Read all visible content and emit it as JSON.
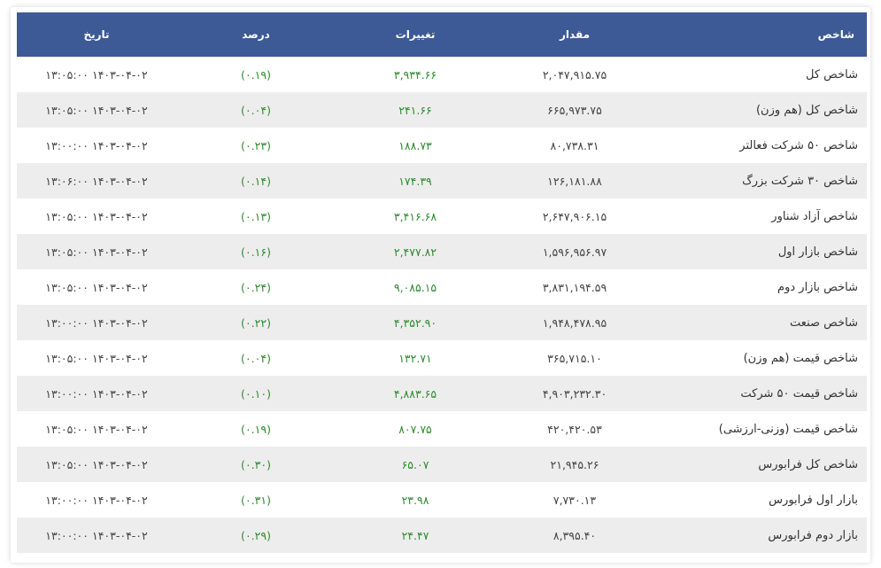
{
  "table": {
    "headers": {
      "name": "شاخص",
      "value": "مقدار",
      "change": "تغییرات",
      "percent": "درصد",
      "date": "تاریخ"
    },
    "rows": [
      {
        "name": "شاخص کل",
        "value": "۲,۰۴۷,۹۱۵.۷۵",
        "change": "۳,۹۳۴.۶۶",
        "percent": "(۰.۱۹)",
        "date": "۱۴۰۳-۰۴-۰۲ ۱۳:۰۵:۰۰"
      },
      {
        "name": "شاخص کل (هم وزن)",
        "value": "۶۶۵,۹۷۳.۷۵",
        "change": "۲۴۱.۶۶",
        "percent": "(۰.۰۴)",
        "date": "۱۴۰۳-۰۴-۰۲ ۱۳:۰۵:۰۰"
      },
      {
        "name": "شاخص ۵۰ شرکت فعالتر",
        "value": "۸۰,۷۳۸.۳۱",
        "change": "۱۸۸.۷۳",
        "percent": "(۰.۲۳)",
        "date": "۱۴۰۳-۰۴-۰۲ ۱۳:۰۰:۰۰"
      },
      {
        "name": "شاخص ۳۰ شرکت بزرگ",
        "value": "۱۲۶,۱۸۱.۸۸",
        "change": "۱۷۴.۳۹",
        "percent": "(۰.۱۴)",
        "date": "۱۴۰۳-۰۴-۰۲ ۱۳:۰۶:۰۰"
      },
      {
        "name": "شاخص آزاد شناور",
        "value": "۲,۶۴۷,۹۰۶.۱۵",
        "change": "۳,۴۱۶.۶۸",
        "percent": "(۰.۱۳)",
        "date": "۱۴۰۳-۰۴-۰۲ ۱۳:۰۵:۰۰"
      },
      {
        "name": "شاخص بازار اول",
        "value": "۱,۵۹۶,۹۵۶.۹۷",
        "change": "۲,۴۷۷.۸۲",
        "percent": "(۰.۱۶)",
        "date": "۱۴۰۳-۰۴-۰۲ ۱۳:۰۵:۰۰"
      },
      {
        "name": "شاخص بازار دوم",
        "value": "۳,۸۳۱,۱۹۴.۵۹",
        "change": "۹,۰۸۵.۱۵",
        "percent": "(۰.۲۴)",
        "date": "۱۴۰۳-۰۴-۰۲ ۱۳:۰۵:۰۰"
      },
      {
        "name": "شاخص صنعت",
        "value": "۱,۹۴۸,۴۷۸.۹۵",
        "change": "۴,۳۵۲.۹۰",
        "percent": "(۰.۲۲)",
        "date": "۱۴۰۳-۰۴-۰۲ ۱۳:۰۰:۰۰"
      },
      {
        "name": "شاخص قیمت (هم وزن)",
        "value": "۳۶۵,۷۱۵.۱۰",
        "change": "۱۳۲.۷۱",
        "percent": "(۰.۰۴)",
        "date": "۱۴۰۳-۰۴-۰۲ ۱۳:۰۵:۰۰"
      },
      {
        "name": "شاخص قیمت ۵۰ شرکت",
        "value": "۴,۹۰۳,۲۳۲.۳۰",
        "change": "۴,۸۸۳.۶۵",
        "percent": "(۰.۱۰)",
        "date": "۱۴۰۳-۰۴-۰۲ ۱۳:۰۰:۰۰"
      },
      {
        "name": "شاخص قیمت (وزنی-ارزشی)",
        "value": "۴۲۰,۴۲۰.۵۳",
        "change": "۸۰۷.۷۵",
        "percent": "(۰.۱۹)",
        "date": "۱۴۰۳-۰۴-۰۲ ۱۳:۰۵:۰۰"
      },
      {
        "name": "شاخص کل فرابورس",
        "value": "۲۱,۹۴۵.۲۶",
        "change": "۶۵.۰۷",
        "percent": "(۰.۳۰)",
        "date": "۱۴۰۳-۰۴-۰۲ ۱۳:۰۵:۰۰"
      },
      {
        "name": "بازار اول فرابورس",
        "value": "۷,۷۳۰.۱۳",
        "change": "۲۳.۹۸",
        "percent": "(۰.۳۱)",
        "date": "۱۴۰۳-۰۴-۰۲ ۱۳:۰۰:۰۰"
      },
      {
        "name": "بازار دوم فرابورس",
        "value": "۸,۳۹۵.۴۰",
        "change": "۲۴.۴۷",
        "percent": "(۰.۲۹)",
        "date": "۱۴۰۳-۰۴-۰۲ ۱۳:۰۰:۰۰"
      }
    ]
  },
  "colors": {
    "header_bg": "#3d5a96",
    "positive": "#2f8a2f",
    "row_alt": "#ededed"
  }
}
